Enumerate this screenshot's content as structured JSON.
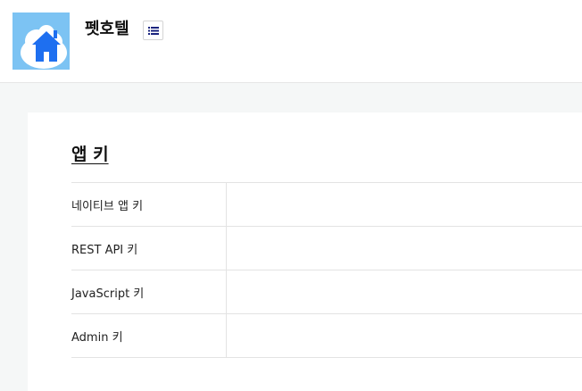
{
  "header": {
    "app_name": "펫호텔",
    "app_icon": "house-icon",
    "menu_icon": "list-icon"
  },
  "section": {
    "title": "앱 키",
    "rows": [
      {
        "label": "네이티브 앱 키",
        "value": ""
      },
      {
        "label": "REST API 키",
        "value": ""
      },
      {
        "label": "JavaScript 키",
        "value": ""
      },
      {
        "label": "Admin 키",
        "value": ""
      }
    ]
  },
  "colors": {
    "icon_background": "#7cc3f3",
    "house_blue": "#1e6ff0",
    "menu_icon": "#1a237e",
    "page_background": "#f5f7f7"
  }
}
